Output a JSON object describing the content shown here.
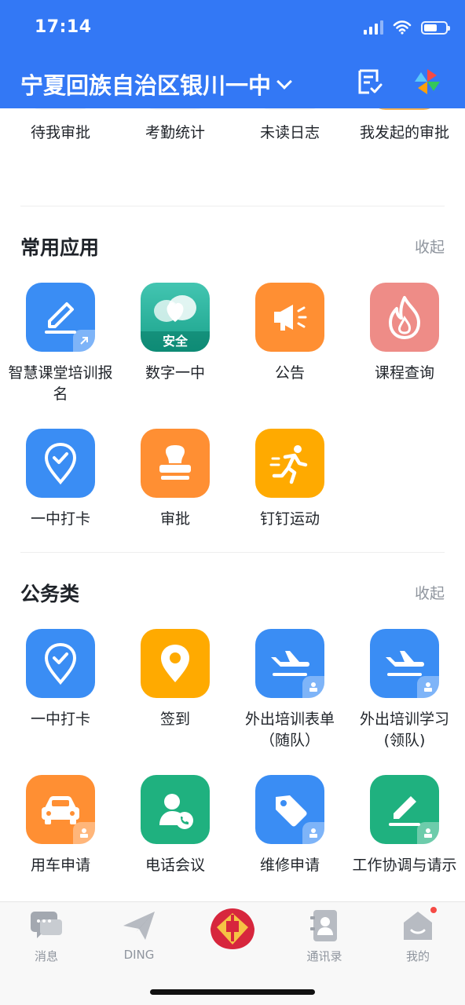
{
  "status_bar": {
    "time": "17:14"
  },
  "header": {
    "org_name": "宁夏回族自治区银川一中"
  },
  "approval_row": {
    "items": [
      {
        "label": "待我审批"
      },
      {
        "label": "考勤统计"
      },
      {
        "label": "未读日志"
      },
      {
        "label": "我发起的审批"
      }
    ]
  },
  "common_apps": {
    "title": "常用应用",
    "action": "收起",
    "items": [
      {
        "label": "智慧课堂培训报名",
        "icon": "edit-pen-icon",
        "color": "#3a8df4"
      },
      {
        "label": "数字一中",
        "icon": "cloud-heart-icon",
        "color": "#1fb17f",
        "badge": "安全"
      },
      {
        "label": "公告",
        "icon": "megaphone-icon",
        "color": "#ff8f33"
      },
      {
        "label": "课程查询",
        "icon": "flame-icon",
        "color": "#ee8c87"
      },
      {
        "label": "一中打卡",
        "icon": "location-check-icon",
        "color": "#3a8df4"
      },
      {
        "label": "审批",
        "icon": "stamp-icon",
        "color": "#ff8f33"
      },
      {
        "label": "钉钉运动",
        "icon": "runner-icon",
        "color": "#ffaa00"
      }
    ]
  },
  "office_apps": {
    "title": "公务类",
    "action": "收起",
    "items": [
      {
        "label": "一中打卡",
        "icon": "location-check-icon",
        "color": "#3a8df4"
      },
      {
        "label": "签到",
        "icon": "location-pin-icon",
        "color": "#ffaa00"
      },
      {
        "label": "外出培训表单（随队）",
        "icon": "airplane-icon",
        "color": "#3a8df4"
      },
      {
        "label": "外出培训学习(领队)",
        "icon": "airplane-icon",
        "color": "#3a8df4"
      },
      {
        "label": "用车申请",
        "icon": "car-icon",
        "color": "#ff8f33"
      },
      {
        "label": "电话会议",
        "icon": "phone-person-icon",
        "color": "#1fb17f"
      },
      {
        "label": "维修申请",
        "icon": "tag-icon",
        "color": "#3a8df4"
      },
      {
        "label": "工作协调与请示",
        "icon": "edit-pen-icon",
        "color": "#1fb17f"
      }
    ]
  },
  "tabbar": {
    "items": [
      {
        "label": "消息",
        "icon": "chat-bubble-icon"
      },
      {
        "label": "DING",
        "icon": "paper-plane-icon"
      },
      {
        "label": "",
        "icon": "school-logo-icon"
      },
      {
        "label": "通讯录",
        "icon": "contacts-icon"
      },
      {
        "label": "我的",
        "icon": "home-profile-icon",
        "has_notification": true
      }
    ]
  }
}
